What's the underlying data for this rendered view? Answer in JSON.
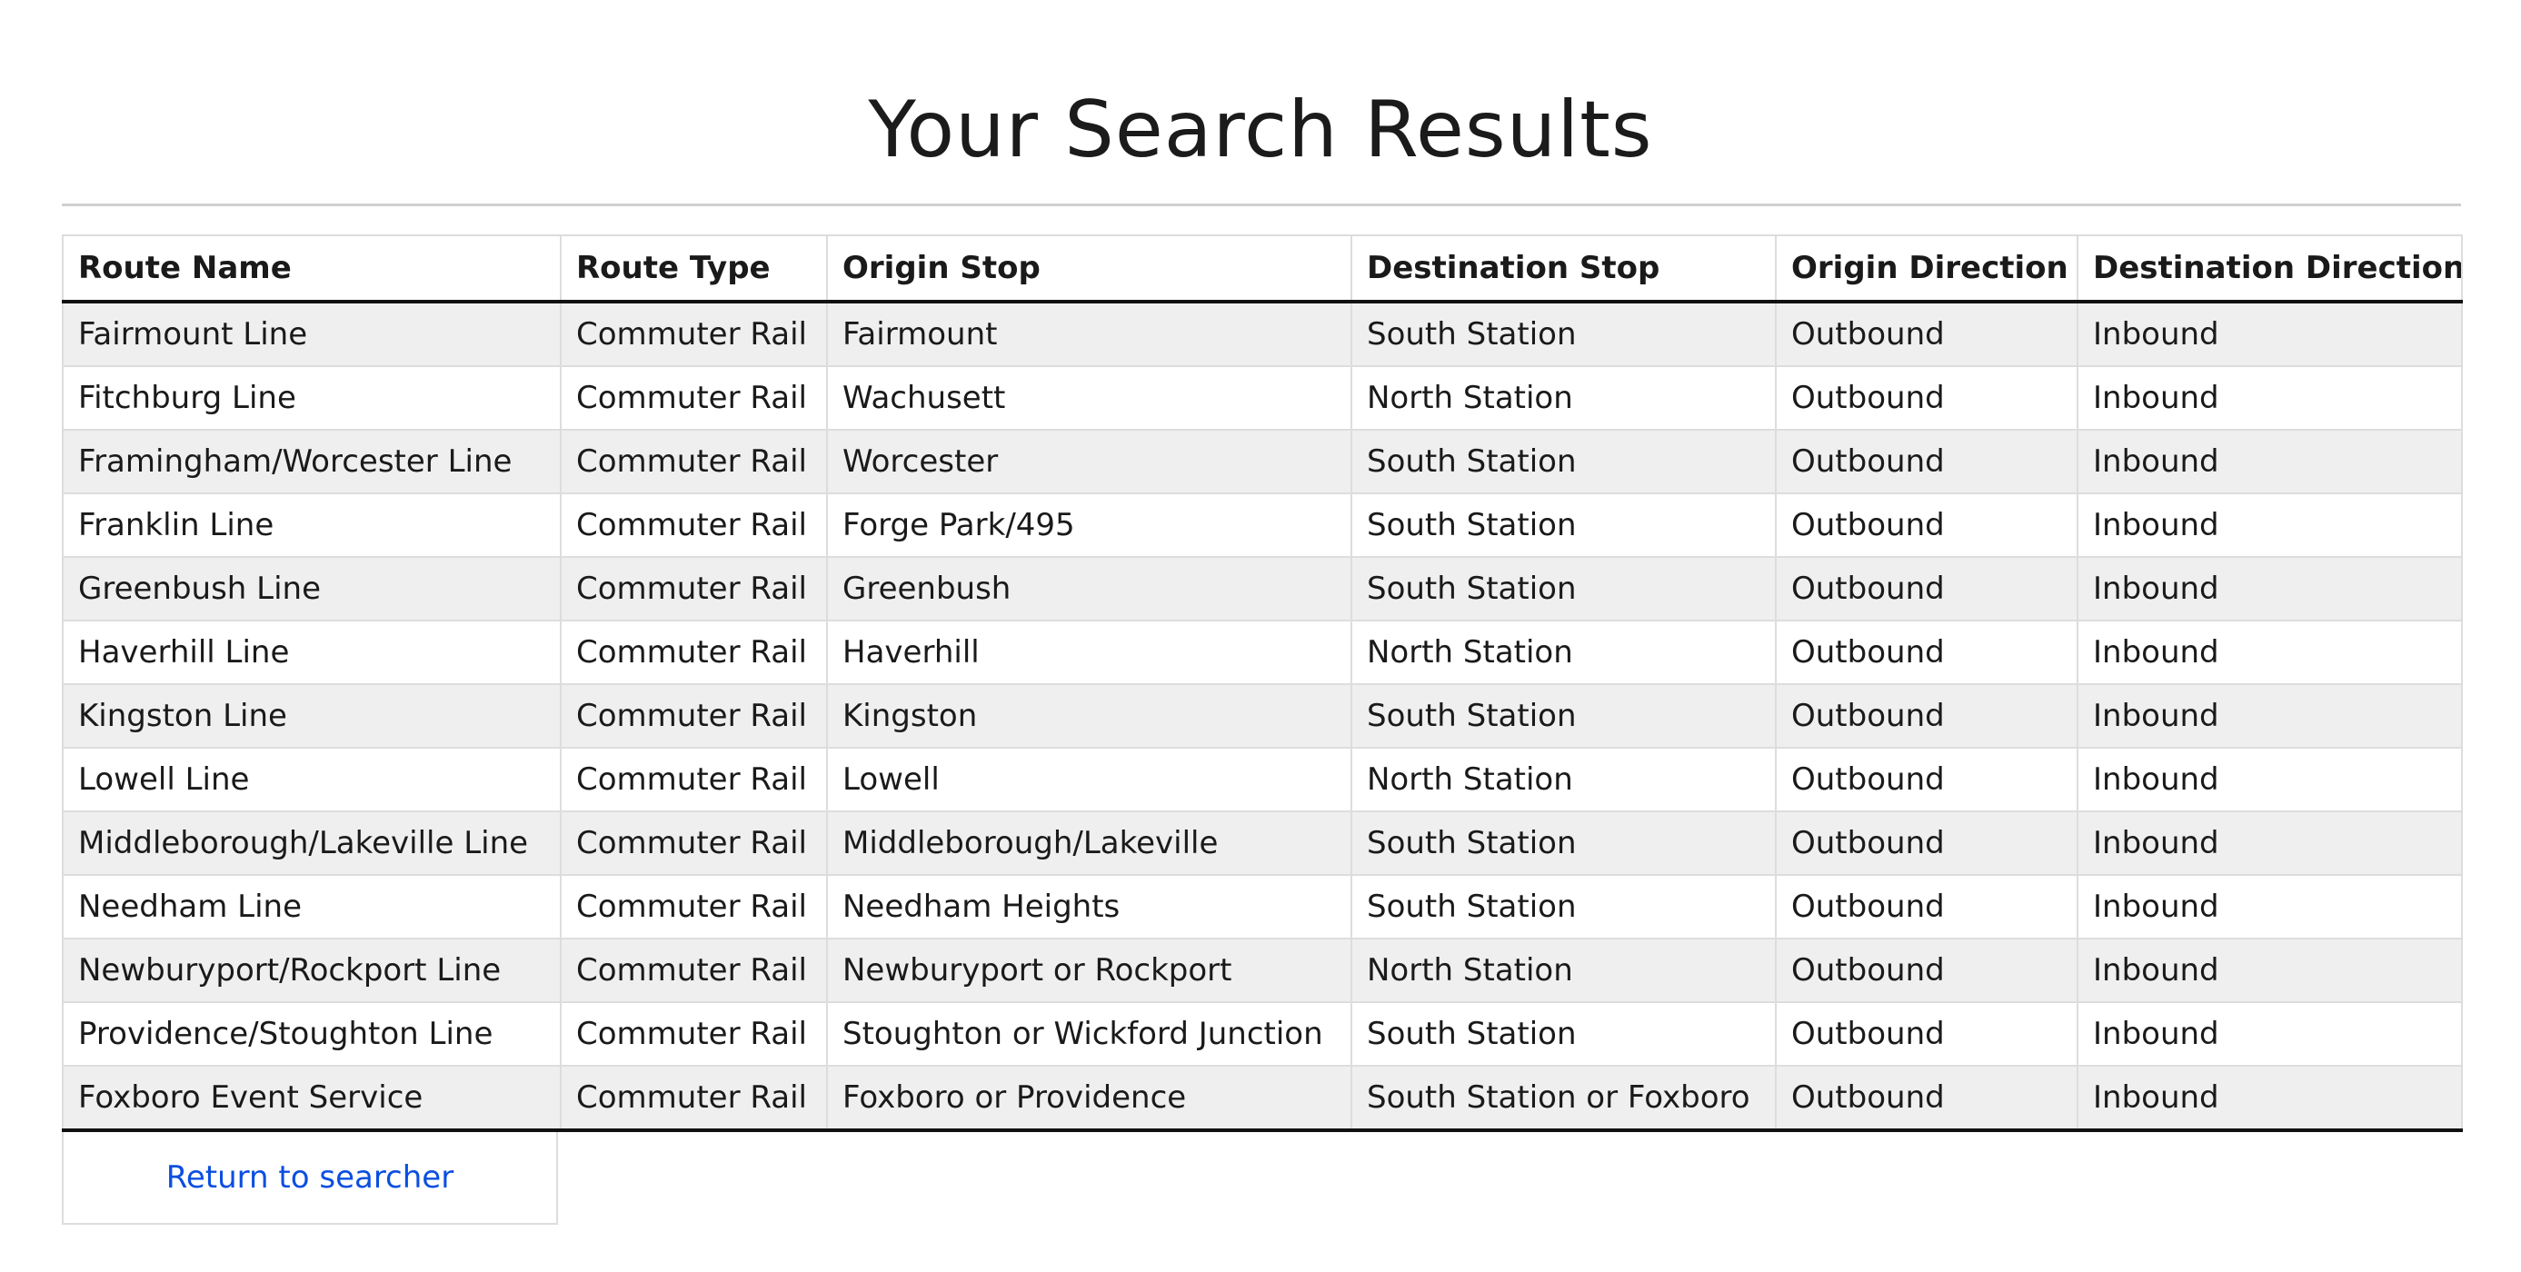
{
  "page": {
    "title": "Your Search Results"
  },
  "table": {
    "headers": [
      "Route Name",
      "Route Type",
      "Origin Stop",
      "Destination Stop",
      "Origin Direction",
      "Destination Direction"
    ],
    "rows": [
      [
        "Fairmount Line",
        "Commuter Rail",
        "Fairmount",
        "South Station",
        "Outbound",
        "Inbound"
      ],
      [
        "Fitchburg Line",
        "Commuter Rail",
        "Wachusett",
        "North Station",
        "Outbound",
        "Inbound"
      ],
      [
        "Framingham/Worcester Line",
        "Commuter Rail",
        "Worcester",
        "South Station",
        "Outbound",
        "Inbound"
      ],
      [
        "Franklin Line",
        "Commuter Rail",
        "Forge Park/495",
        "South Station",
        "Outbound",
        "Inbound"
      ],
      [
        "Greenbush Line",
        "Commuter Rail",
        "Greenbush",
        "South Station",
        "Outbound",
        "Inbound"
      ],
      [
        "Haverhill Line",
        "Commuter Rail",
        "Haverhill",
        "North Station",
        "Outbound",
        "Inbound"
      ],
      [
        "Kingston Line",
        "Commuter Rail",
        "Kingston",
        "South Station",
        "Outbound",
        "Inbound"
      ],
      [
        "Lowell Line",
        "Commuter Rail",
        "Lowell",
        "North Station",
        "Outbound",
        "Inbound"
      ],
      [
        "Middleborough/Lakeville Line",
        "Commuter Rail",
        "Middleborough/Lakeville",
        "South Station",
        "Outbound",
        "Inbound"
      ],
      [
        "Needham Line",
        "Commuter Rail",
        "Needham Heights",
        "South Station",
        "Outbound",
        "Inbound"
      ],
      [
        "Newburyport/Rockport Line",
        "Commuter Rail",
        "Newburyport or Rockport",
        "North Station",
        "Outbound",
        "Inbound"
      ],
      [
        "Providence/Stoughton Line",
        "Commuter Rail",
        "Stoughton or Wickford Junction",
        "South Station",
        "Outbound",
        "Inbound"
      ],
      [
        "Foxboro Event Service",
        "Commuter Rail",
        "Foxboro or Providence",
        "South Station or Foxboro",
        "Outbound",
        "Inbound"
      ]
    ]
  },
  "footer": {
    "return_label": "Return to searcher"
  },
  "colors": {
    "link": "#0b4fe0",
    "row_stripe": "#efefef",
    "border": "#dddddd"
  }
}
